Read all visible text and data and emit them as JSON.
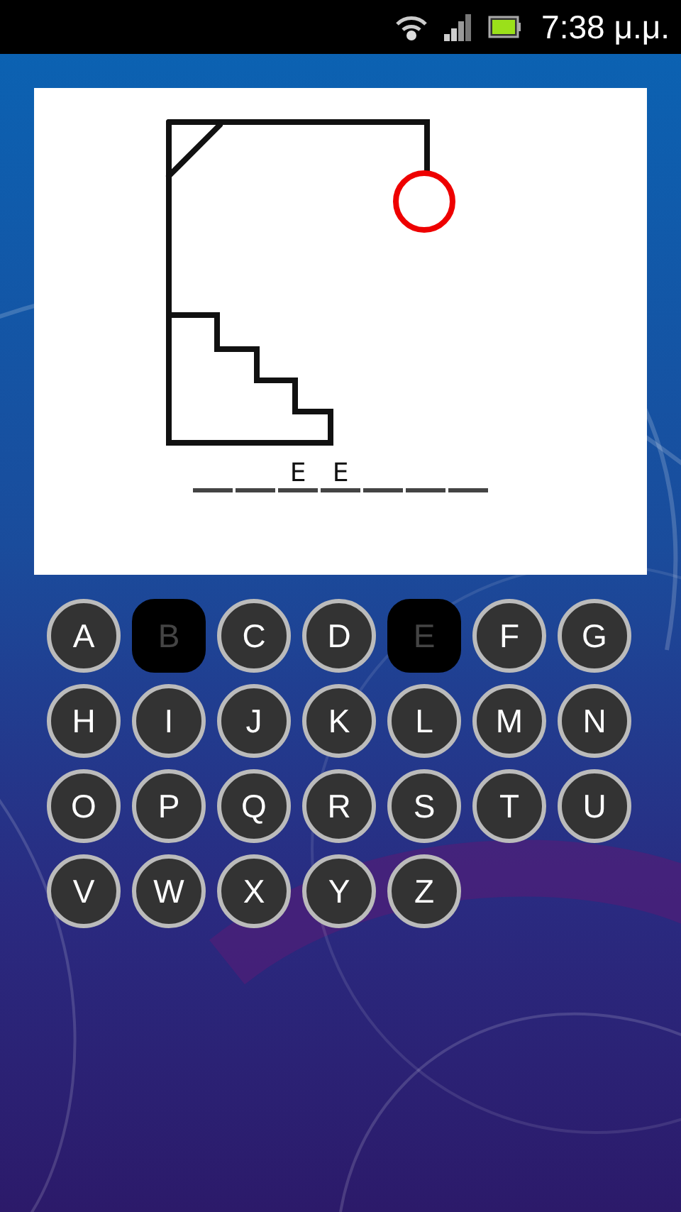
{
  "status_bar": {
    "time": "7:38 μ.μ."
  },
  "word": {
    "slots": [
      {
        "kind": "blank"
      },
      {
        "kind": "blank"
      },
      {
        "kind": "letter",
        "letter": "E"
      },
      {
        "kind": "letter",
        "letter": "E"
      },
      {
        "kind": "blank"
      },
      {
        "kind": "blank"
      },
      {
        "kind": "blank"
      }
    ]
  },
  "keyboard": [
    {
      "letter": "A",
      "used": false
    },
    {
      "letter": "B",
      "used": true
    },
    {
      "letter": "C",
      "used": false
    },
    {
      "letter": "D",
      "used": false
    },
    {
      "letter": "E",
      "used": true
    },
    {
      "letter": "F",
      "used": false
    },
    {
      "letter": "G",
      "used": false
    },
    {
      "letter": "H",
      "used": false
    },
    {
      "letter": "I",
      "used": false
    },
    {
      "letter": "J",
      "used": false
    },
    {
      "letter": "K",
      "used": false
    },
    {
      "letter": "L",
      "used": false
    },
    {
      "letter": "M",
      "used": false
    },
    {
      "letter": "N",
      "used": false
    },
    {
      "letter": "O",
      "used": false
    },
    {
      "letter": "P",
      "used": false
    },
    {
      "letter": "Q",
      "used": false
    },
    {
      "letter": "R",
      "used": false
    },
    {
      "letter": "S",
      "used": false
    },
    {
      "letter": "T",
      "used": false
    },
    {
      "letter": "U",
      "used": false
    },
    {
      "letter": "V",
      "used": false
    },
    {
      "letter": "W",
      "used": false
    },
    {
      "letter": "X",
      "used": false
    },
    {
      "letter": "Y",
      "used": false
    },
    {
      "letter": "Z",
      "used": false
    }
  ]
}
